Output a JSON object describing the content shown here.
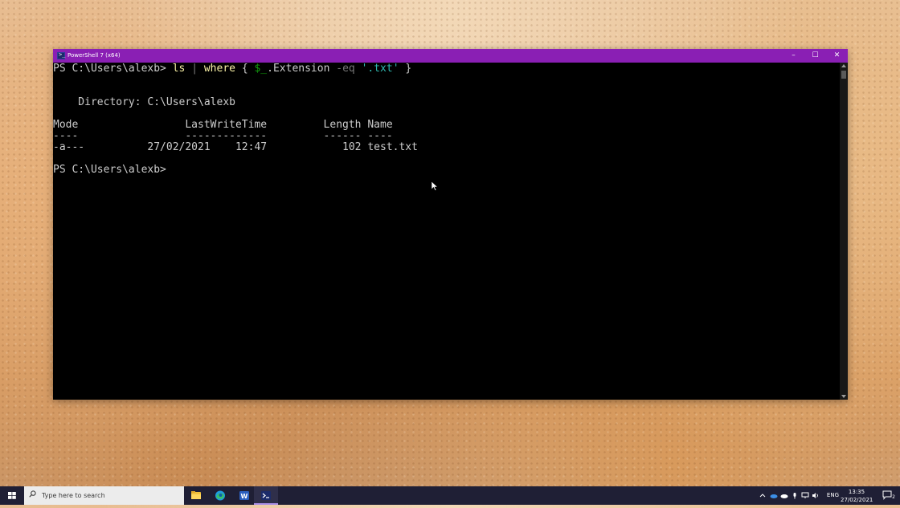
{
  "window": {
    "title": "PowerShell 7 (x64)",
    "minimize_glyph": "–",
    "maximize_glyph": "☐",
    "close_glyph": "✕",
    "titlebar_color": "#8a1fb4"
  },
  "terminal": {
    "prompt": "PS C:\\Users\\alexb>",
    "command": {
      "cmd1": "ls",
      "pipe": "|",
      "cmd2": "where",
      "brace_open": "{",
      "var": "$_",
      "prop": ".Extension",
      "op": "-eq",
      "str": "'.txt'",
      "brace_close": "}"
    },
    "directory_line": "    Directory: C:\\Users\\alexb",
    "header_line": "Mode                 LastWriteTime         Length Name",
    "separator_line": "----                 -------------         ------ ----",
    "row_line": "-a---          27/02/2021    12:47            102 test.txt",
    "final_prompt": "PS C:\\Users\\alexb>"
  },
  "taskbar": {
    "search_placeholder": "Type here to search",
    "apps": [
      "file-explorer-icon",
      "edge-icon",
      "word-icon",
      "terminal-icon"
    ],
    "language": "ENG",
    "time": "13:35",
    "date": "27/02/2021",
    "notification_count": "2"
  }
}
